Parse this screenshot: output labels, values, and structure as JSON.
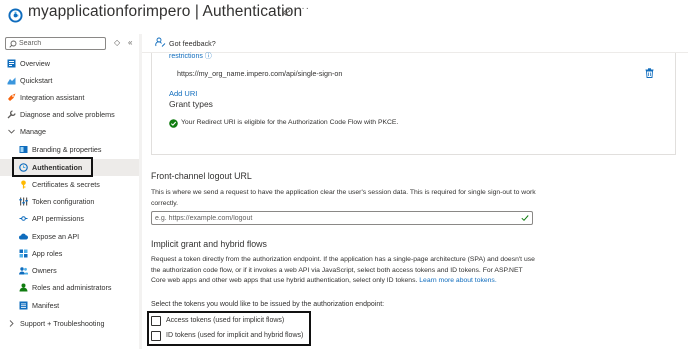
{
  "header": {
    "title": "myapplicationforimpero | Authentication",
    "more_glyph": "···",
    "logo_icon": "app-registration-icon",
    "pin_icon": "pin-icon"
  },
  "sidebar": {
    "search_placeholder": "Search",
    "collapse_glyph": "«",
    "expand_glyph": "◇",
    "items": [
      {
        "label": "Overview",
        "icon": "overview-icon"
      },
      {
        "label": "Quickstart",
        "icon": "quickstart-icon"
      },
      {
        "label": "Integration assistant",
        "icon": "rocket-icon"
      },
      {
        "label": "Diagnose and solve problems",
        "icon": "wrench-icon"
      },
      {
        "label": "Manage",
        "icon": "chevron-down-icon"
      },
      {
        "label": "Branding & properties",
        "icon": "branding-icon"
      },
      {
        "label": "Authentication",
        "icon": "authentication-icon",
        "active": true
      },
      {
        "label": "Certificates & secrets",
        "icon": "key-icon"
      },
      {
        "label": "Token configuration",
        "icon": "token-icon"
      },
      {
        "label": "API permissions",
        "icon": "api-permissions-icon"
      },
      {
        "label": "Expose an API",
        "icon": "cloud-icon"
      },
      {
        "label": "App roles",
        "icon": "app-roles-icon"
      },
      {
        "label": "Owners",
        "icon": "owners-icon"
      },
      {
        "label": "Roles and administrators",
        "icon": "roles-icon"
      },
      {
        "label": "Manifest",
        "icon": "manifest-icon"
      },
      {
        "label": "Support + Troubleshooting",
        "icon": "chevron-right-icon"
      }
    ]
  },
  "content": {
    "feedback_label": "Got feedback?",
    "restrictions_label": "restrictions ⓘ",
    "redirect_uri": "https://my_org_name.impero.com/api/single-sign-on",
    "add_uri_label": "Add URI",
    "grant_types_title": "Grant types",
    "pkce_message": "Your Redirect URI is eligible for the Authorization Code Flow with PKCE.",
    "logout": {
      "title": "Front-channel logout URL",
      "description": "This is where we send a request to have the application clear the user's session data. This is required for single sign-out to work correctly.",
      "placeholder": "e.g. https://example.com/logout"
    },
    "implicit": {
      "title": "Implicit grant and hybrid flows",
      "description": "Request a token directly from the authorization endpoint. If the application has a single-page architecture (SPA) and doesn't use the authorization code flow, or if it invokes a web API via JavaScript, select both access tokens and ID tokens. For ASP.NET Core web apps and other web apps that use hybrid authentication, select only ID tokens.",
      "learn_more": "Learn more about tokens.",
      "select_label": "Select the tokens you would like to be issued by the authorization endpoint:",
      "access_tokens_label": "Access tokens (used for implicit flows)",
      "access_tokens_checked": false,
      "id_tokens_label": "ID tokens (used for implicit and hybrid flows)",
      "id_tokens_checked": false
    }
  },
  "colors": {
    "accent": "#0f6cbd",
    "success": "#107c10",
    "active_bg": "#edebe9"
  }
}
